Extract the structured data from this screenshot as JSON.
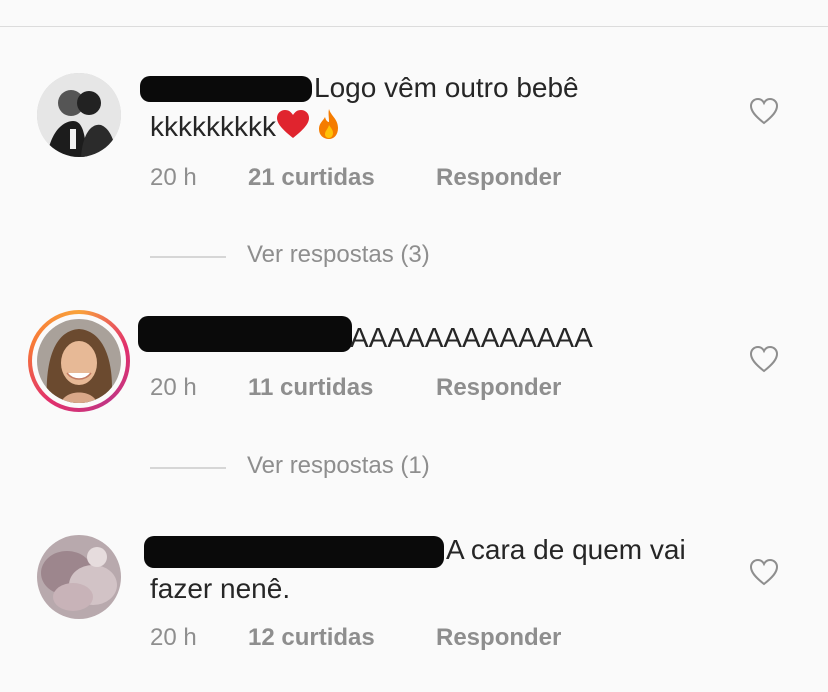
{
  "comments": [
    {
      "text_line1": "Logo vêm outro bebê",
      "text_line2": "kkkkkkkkk",
      "emojis": [
        "red-heart",
        "fire"
      ],
      "time": "20 h",
      "likes": "21 curtidas",
      "reply": "Responder",
      "view_replies": "Ver respostas (3)",
      "avatar_story_ring": false
    },
    {
      "text_line1": "AAAAAAAAAAAAA",
      "time": "20 h",
      "likes": "11 curtidas",
      "reply": "Responder",
      "view_replies": "Ver respostas (1)",
      "avatar_story_ring": true
    },
    {
      "text_line1": "A cara de quem vai",
      "text_line2": "fazer nenê.",
      "time": "20 h",
      "likes": "12 curtidas",
      "reply": "Responder"
    }
  ],
  "colors": {
    "background": "#fafafa",
    "text": "#262626",
    "muted": "#8e8e8e",
    "heart_emoji": "#e0242e",
    "fire_emoji": "#f57c00",
    "ring_gradient": [
      "#f9a33a",
      "#e1306c",
      "#c13584"
    ]
  },
  "icons": {
    "like": "heart-outline-icon"
  }
}
